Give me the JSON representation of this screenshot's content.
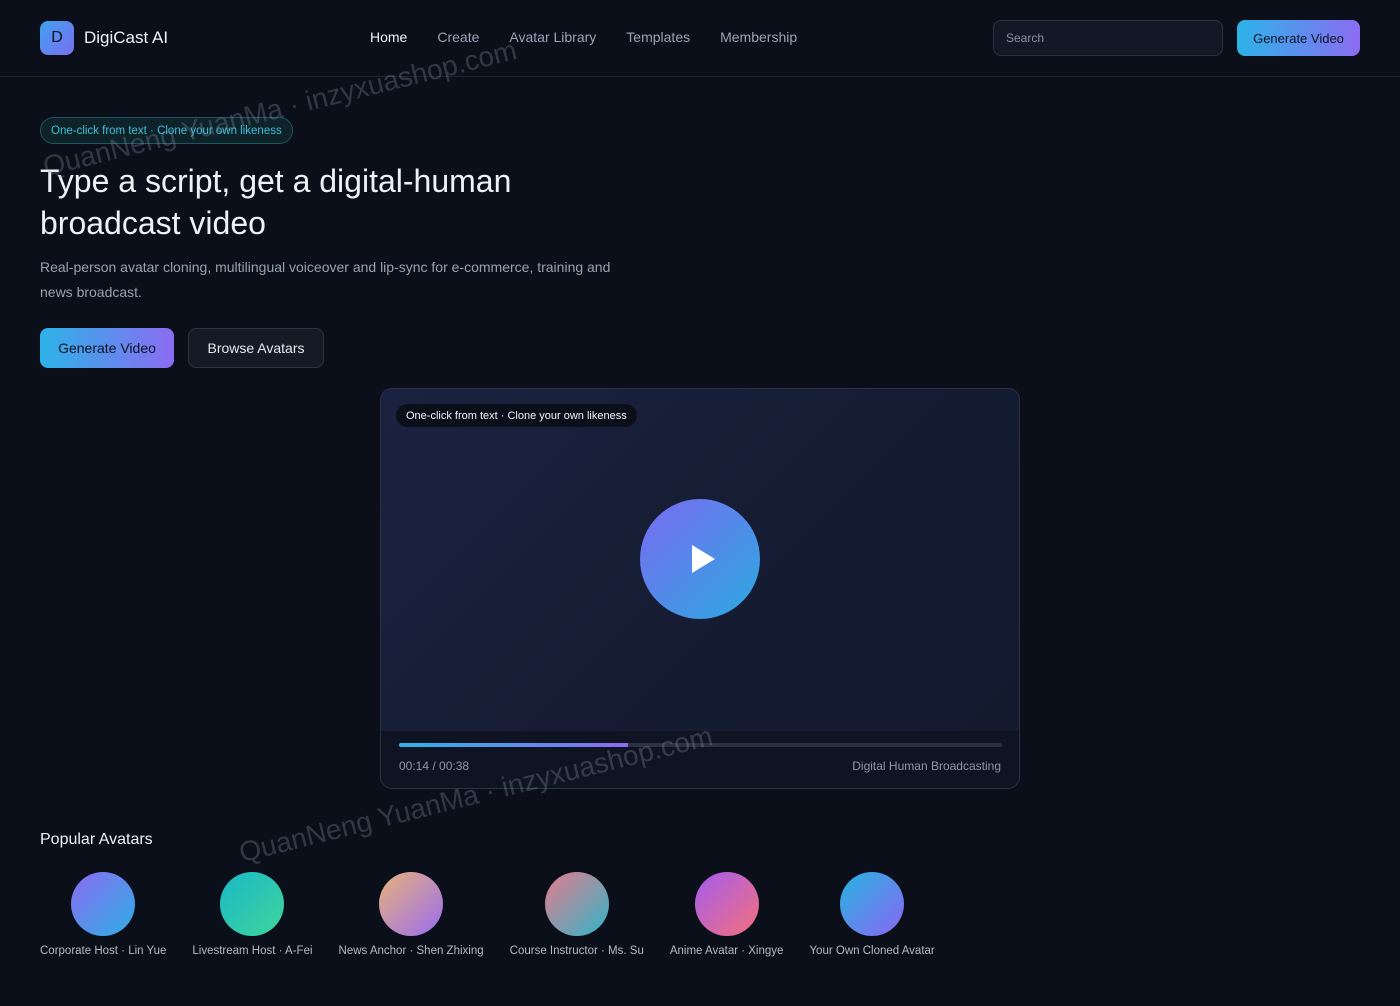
{
  "header": {
    "logo_letter": "D",
    "app_name": "DigiCast AI",
    "nav": [
      "Home",
      "Create",
      "Avatar Library",
      "Templates",
      "Membership"
    ],
    "search_placeholder": "Search",
    "cta": "Generate Video"
  },
  "hero": {
    "badge": "One-click from text · Clone your own likeness",
    "title": "Type a script, get a digital-human broadcast video",
    "description": "Real-person avatar cloning, multilingual voiceover and lip-sync for e-commerce, training and news broadcast.",
    "primary_button": "Generate Video",
    "secondary_button": "Browse Avatars"
  },
  "player": {
    "tag": "One-click from text · Clone your own likeness",
    "progress_percent": 38,
    "time": "00:14 / 00:38",
    "caption": "Digital Human Broadcasting"
  },
  "avatars": {
    "title": "Popular Avatars",
    "items": [
      {
        "label": "Corporate Host · Lin Yue",
        "color_a": "#8a6cf2",
        "color_b": "#2eaee4"
      },
      {
        "label": "Livestream Host · A-Fei",
        "color_a": "#19b8c8",
        "color_b": "#3fd69a"
      },
      {
        "label": "News Anchor · Shen Zhixing",
        "color_a": "#e7b27a",
        "color_b": "#9a6cf0"
      },
      {
        "label": "Course Instructor · Ms. Su",
        "color_a": "#e57c8c",
        "color_b": "#2fb5c8"
      },
      {
        "label": "Anime Avatar · Xingye",
        "color_a": "#a35cf0",
        "color_b": "#f4707a"
      },
      {
        "label": "Your Own Cloned Avatar",
        "color_a": "#26b4e0",
        "color_b": "#8a66f2"
      }
    ]
  },
  "watermark": "QuanNeng YuanMa · inzyxuashop.com"
}
